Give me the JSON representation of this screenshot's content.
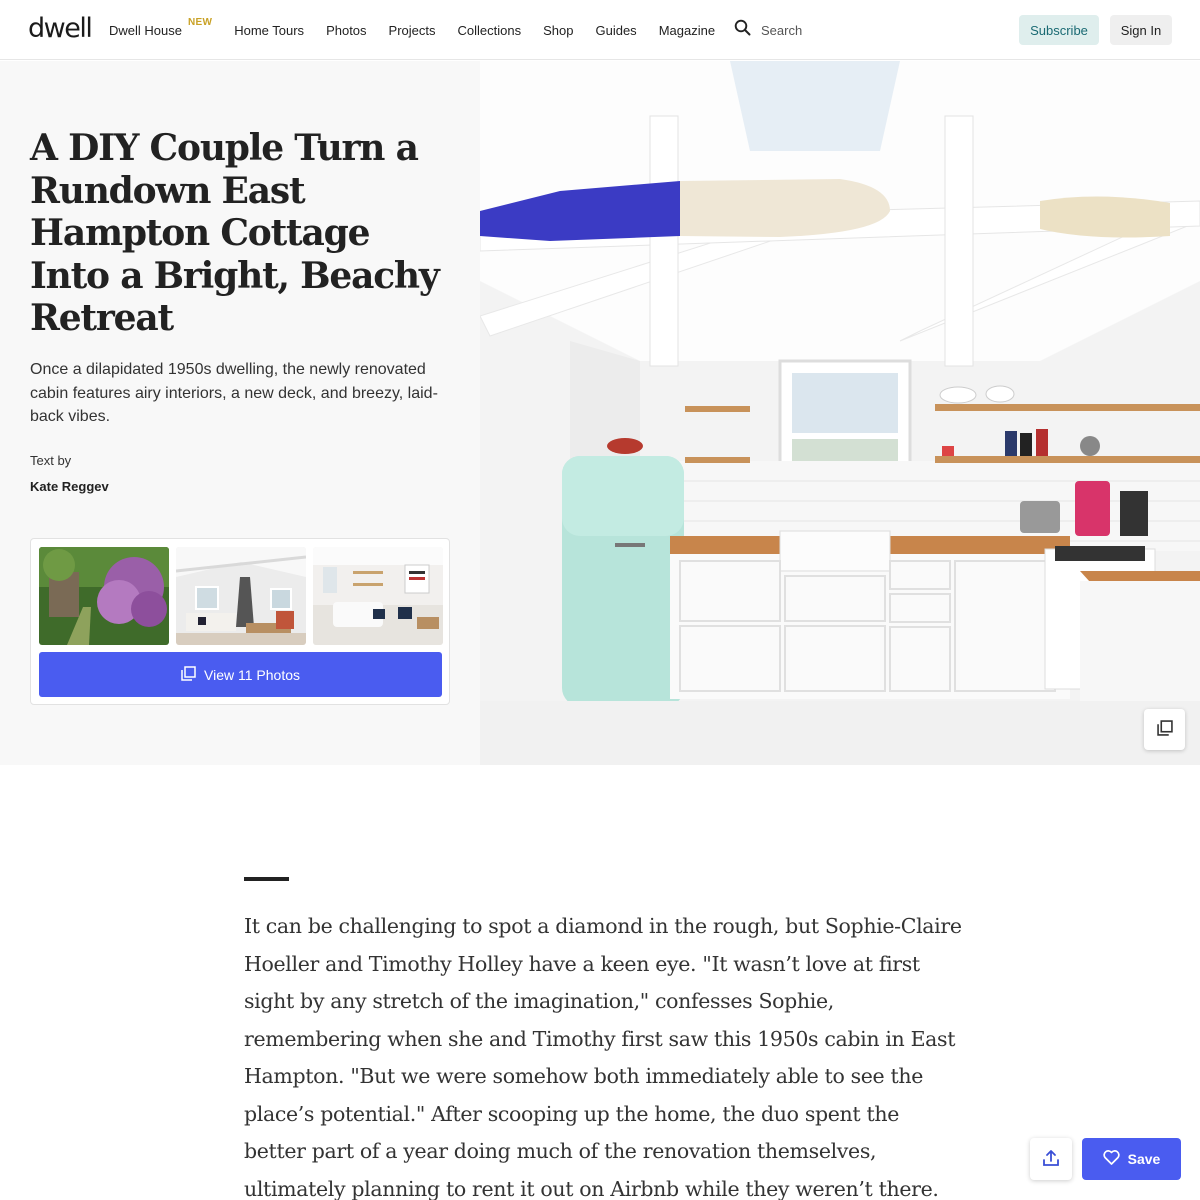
{
  "nav": {
    "logo": "dwell",
    "links": [
      {
        "label": "Dwell House",
        "badge": "NEW"
      },
      {
        "label": "Home Tours"
      },
      {
        "label": "Photos"
      },
      {
        "label": "Projects"
      },
      {
        "label": "Collections"
      },
      {
        "label": "Shop"
      },
      {
        "label": "Guides"
      },
      {
        "label": "Magazine"
      }
    ],
    "search_label": "Search",
    "search_icon": "search-icon",
    "subscribe_label": "Subscribe",
    "signin_label": "Sign In"
  },
  "hero": {
    "title": "A DIY Couple Turn a Rundown East Hampton Cottage Into a Bright, Beachy Retreat",
    "dek": "Once a dilapidated 1950s dwelling, the newly renovated cabin features airy interiors, a new deck, and breezy, laid-back vibes.",
    "byline_label": "Text by",
    "author": "Kate Reggev",
    "view_photos_label": "View 11 Photos",
    "gallery_icon": "gallery-icon",
    "expand_icon": "gallery-icon"
  },
  "article": {
    "body": "It can be challenging to spot a diamond in the rough, but Sophie-Claire Hoeller and Timothy Holley have a keen eye. \"It wasn’t love at first sight by any stretch of the imagination,\" confesses Sophie, remembering when she and Timothy first saw this 1950s cabin in East Hampton. \"But we were somehow both immediately able to see the place’s potential.\" After scooping up the home, the duo spent the better part of a year doing much of the renovation themselves, ultimately planning to rent it out on Airbnb while they weren’t there."
  },
  "actions": {
    "share_icon": "share-icon",
    "save_icon": "heart-icon",
    "save_label": "Save"
  },
  "colors": {
    "accent": "#4a5cf0",
    "subscribe_bg": "#dfeeed",
    "subscribe_text": "#1a6a73",
    "new_badge": "#c9a227",
    "hero_left_bg": "#f8f8f8"
  }
}
